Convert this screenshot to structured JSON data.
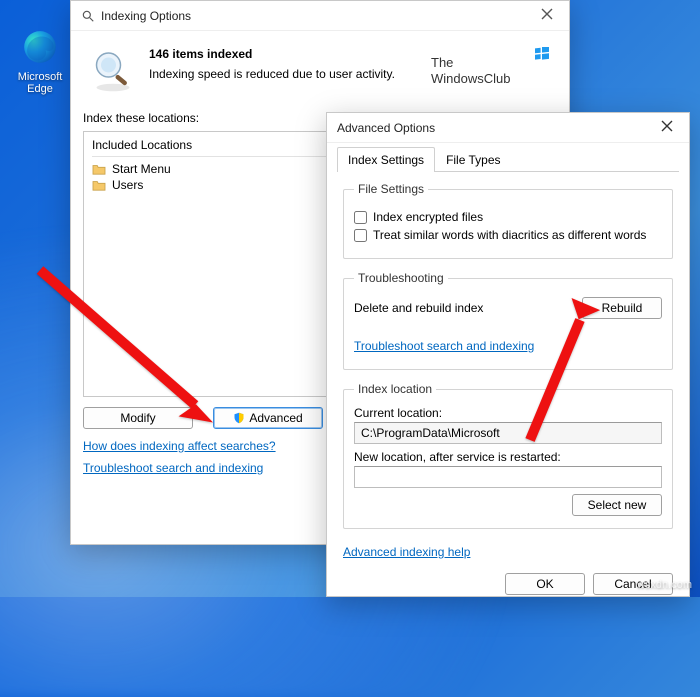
{
  "desktop": {
    "edge_label": "Microsoft Edge"
  },
  "indexing": {
    "title": "Indexing Options",
    "items_indexed": "146 items indexed",
    "speed_note": "Indexing speed is reduced due to user activity.",
    "logo_line1": "The",
    "logo_line2": "WindowsClub",
    "index_these": "Index these locations:",
    "included_header": "Included Locations",
    "locations": [
      {
        "label": "Start Menu"
      },
      {
        "label": "Users"
      }
    ],
    "modify": "Modify",
    "advanced": "Advanced",
    "link_affect": "How does indexing affect searches?",
    "link_trouble": "Troubleshoot search and indexing"
  },
  "advanced": {
    "title": "Advanced Options",
    "tab_index": "Index Settings",
    "tab_filetypes": "File Types",
    "fs_file": "File Settings",
    "chk_encrypted": "Index encrypted files",
    "chk_diacritics": "Treat similar words with diacritics as different words",
    "fs_trouble": "Troubleshooting",
    "delete_rebuild": "Delete and rebuild index",
    "rebuild": "Rebuild",
    "link_trouble": "Troubleshoot search and indexing",
    "fs_loc": "Index location",
    "cur_loc_label": "Current location:",
    "cur_loc_value": "C:\\ProgramData\\Microsoft",
    "new_loc_label": "New location, after service is restarted:",
    "new_loc_value": "",
    "select_new": "Select new",
    "link_help": "Advanced indexing help",
    "ok": "OK",
    "cancel": "Cancel"
  },
  "watermark": "wsxdn.com"
}
